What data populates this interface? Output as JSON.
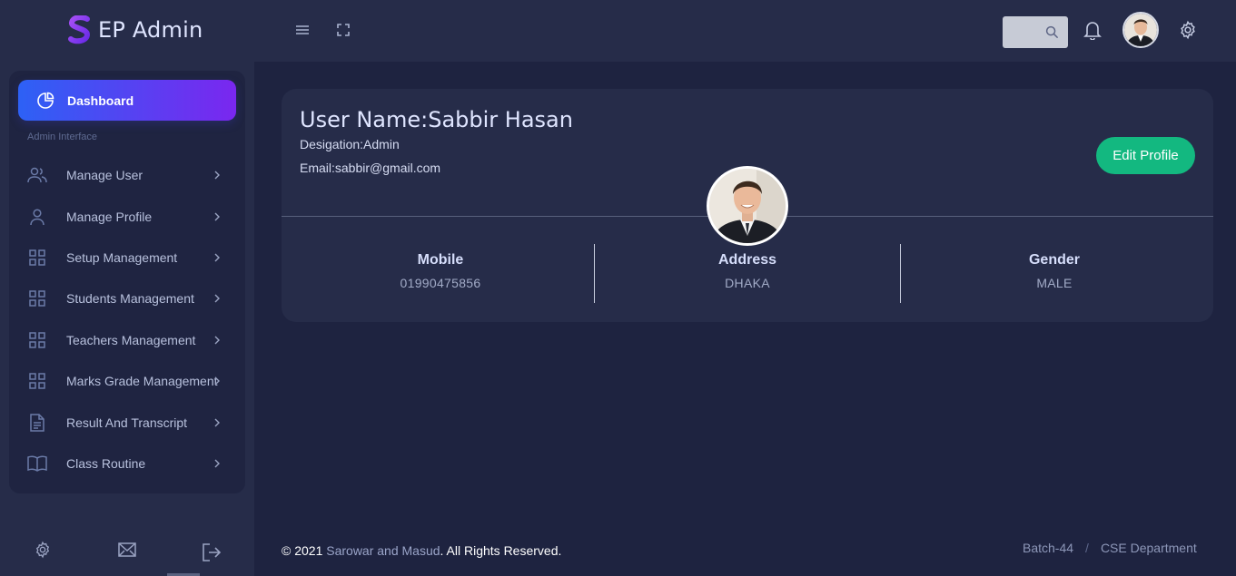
{
  "brand": {
    "name": "EP Admin",
    "logo_icon": "s-logo-icon"
  },
  "topbar": {
    "menu_icon": "hamburger-icon",
    "fullscreen_icon": "fullscreen-icon",
    "search_icon": "search-icon",
    "notification_icon": "bell-icon",
    "settings_icon": "gear-icon"
  },
  "sidebar": {
    "active": {
      "label": "Dashboard",
      "icon": "pie-chart-icon"
    },
    "section_label": "Admin Interface",
    "items": [
      {
        "label": "Manage User",
        "icon": "users-icon"
      },
      {
        "label": "Manage Profile",
        "icon": "user-icon"
      },
      {
        "label": "Setup Management",
        "icon": "grid-icon"
      },
      {
        "label": "Students Management",
        "icon": "grid-icon"
      },
      {
        "label": "Teachers Management",
        "icon": "grid-icon"
      },
      {
        "label": "Marks Grade Management",
        "icon": "grid-icon"
      },
      {
        "label": "Result And Transcript",
        "icon": "document-icon"
      },
      {
        "label": "Class Routine",
        "icon": "book-icon"
      }
    ],
    "footer_icons": [
      "gear-icon",
      "mail-icon",
      "logout-icon"
    ]
  },
  "profile": {
    "name": "User Name:Sabbir Hasan",
    "designation": "Desigation:Admin",
    "email": "Email:sabbir@gmail.com",
    "edit_label": "Edit Profile",
    "stats": [
      {
        "label": "Mobile",
        "value": "01990475856"
      },
      {
        "label": "Address",
        "value": "DHAKA"
      },
      {
        "label": "Gender",
        "value": "MALE"
      }
    ]
  },
  "footer": {
    "copy_prefix": "© 2021 ",
    "copy_link": "Sarowar and Masud",
    "copy_suffix": ". All Rights Reserved.",
    "batch": "Batch-44",
    "separator": "/",
    "department": "CSE Department"
  },
  "colors": {
    "background": "#1e2340",
    "panel": "#262c49",
    "accent_start": "#2d61f5",
    "accent_end": "#7a27ef",
    "success": "#13b880"
  }
}
